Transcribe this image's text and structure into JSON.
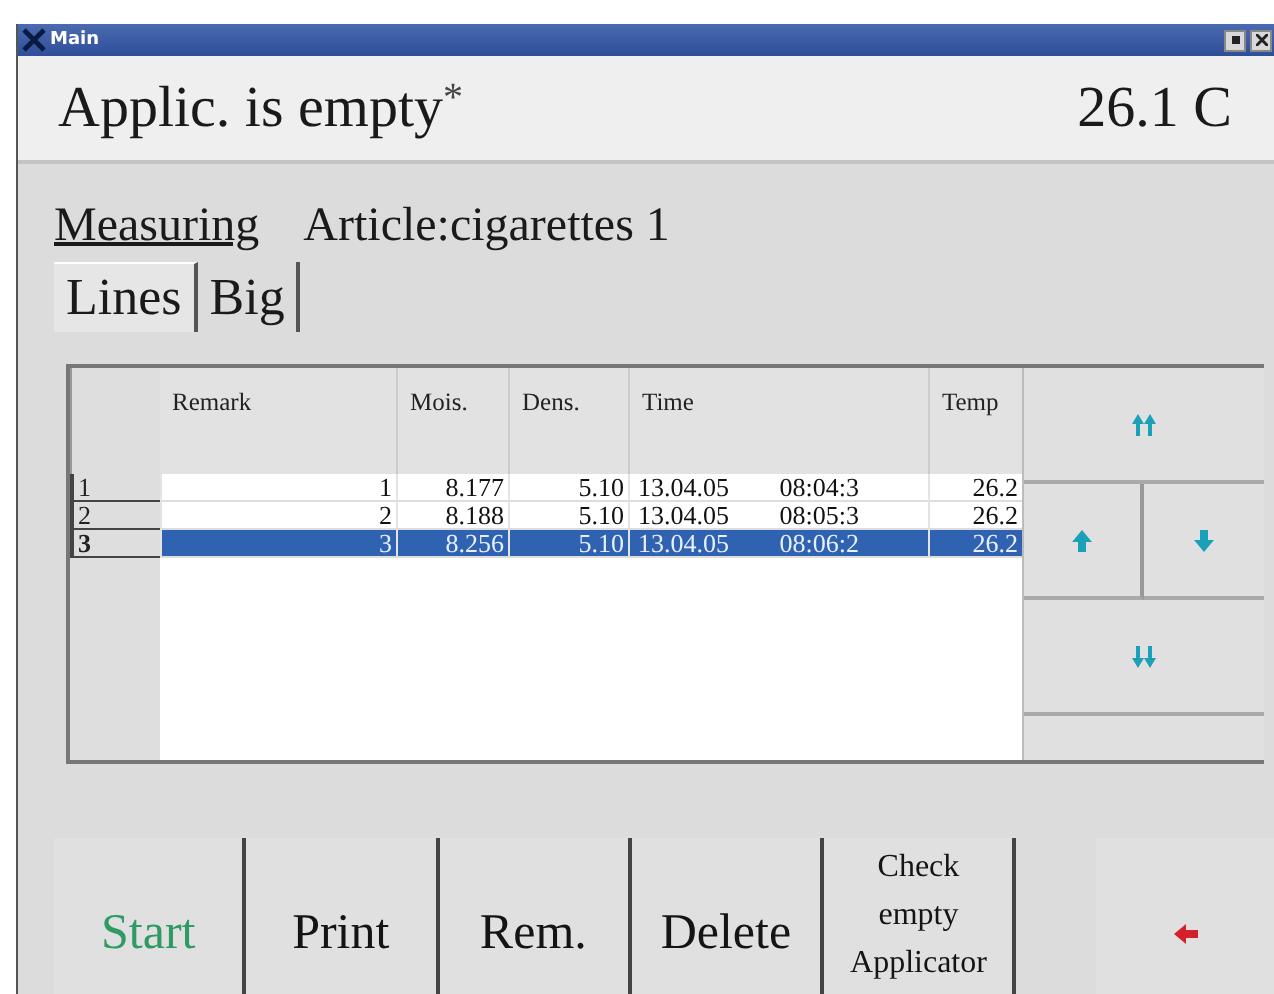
{
  "window": {
    "title": "Main"
  },
  "header": {
    "status": "Applic. is empty",
    "status_mark": "*",
    "temperature": "26.1 C"
  },
  "mode": {
    "label": "Measuring",
    "article": "Article:cigarettes 1"
  },
  "tabs": [
    {
      "label": "Lines",
      "selected": true
    },
    {
      "label": "Big",
      "selected": false
    }
  ],
  "table": {
    "columns": [
      "Remark",
      "Mois.",
      "Dens.",
      "Time",
      "Temp"
    ],
    "rows": [
      {
        "header": "1",
        "cells": [
          "1",
          "8.177",
          "5.10",
          "13.04.05 08:04:3",
          "26.2"
        ],
        "selected": false
      },
      {
        "header": "2",
        "cells": [
          "2",
          "8.188",
          "5.10",
          "13.04.05 08:05:3",
          "26.2"
        ],
        "selected": false
      },
      {
        "header": "3",
        "cells": [
          "3",
          "8.256",
          "5.10",
          "13.04.05 08:06:2",
          "26.2"
        ],
        "selected": true
      }
    ]
  },
  "nav_buttons": [
    {
      "kind": "first"
    },
    {
      "kind": "up"
    },
    {
      "kind": "down"
    },
    {
      "kind": "last"
    }
  ],
  "buttons": [
    {
      "kind": "text",
      "label": "Start",
      "color": "#2f9a63"
    },
    {
      "kind": "text",
      "label": "Print",
      "color": "#141414"
    },
    {
      "kind": "text",
      "label": "Rem.",
      "color": "#141414"
    },
    {
      "kind": "text",
      "label": "Delete",
      "color": "#141414"
    },
    {
      "kind": "small",
      "label": "Check empty Applicator",
      "color": "#141414"
    },
    {
      "kind": "spacer"
    },
    {
      "kind": "back"
    }
  ]
}
